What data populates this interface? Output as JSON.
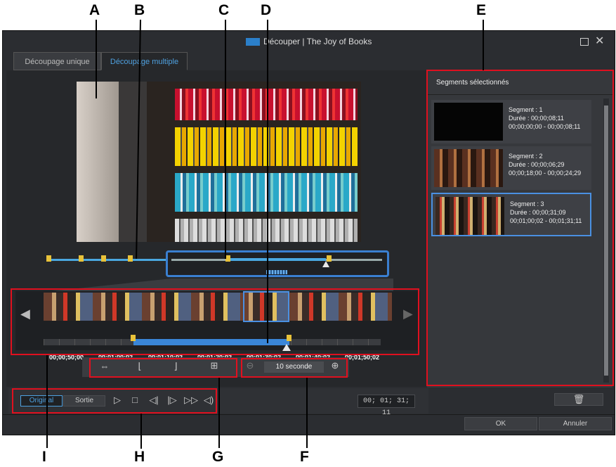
{
  "window": {
    "title": "Découper | The Joy of Books"
  },
  "tabs": [
    {
      "label": "Découpage unique",
      "active": false
    },
    {
      "label": "Découpage multiple",
      "active": true
    }
  ],
  "segments_panel": {
    "title": "Segments sélectionnés",
    "segments": [
      {
        "label": "Segment : 1",
        "duration": "Durée : 00;00;08;11",
        "range": "00;00;00;00 - 00;00;08;11",
        "selected": false
      },
      {
        "label": "Segment : 2",
        "duration": "Durée : 00;00;06;29",
        "range": "00;00;18;00 - 00;00;24;29",
        "selected": false
      },
      {
        "label": "Segment : 3",
        "duration": "Durée : 00;00;31;09",
        "range": "00;01;00;02 - 00;01;31;11",
        "selected": true
      }
    ]
  },
  "filmstrip": {
    "timestamps": [
      "00;00;50;00",
      "00;01;00;02",
      "00;01;10;02",
      "00;01;20;02",
      "00;01;30;02",
      "00;01;40;02",
      "00;01;50;02"
    ]
  },
  "zoom": {
    "value": "10 seconde"
  },
  "playback": {
    "original_label": "Original",
    "output_label": "Sortie",
    "timecode": "00; 01; 31; 11"
  },
  "footer": {
    "ok_label": "OK",
    "cancel_label": "Annuler"
  },
  "callouts": {
    "A": "A",
    "B": "B",
    "C": "C",
    "D": "D",
    "E": "E",
    "F": "F",
    "G": "G",
    "H": "H",
    "I": "I"
  },
  "colors": {
    "accent": "#4ea0df",
    "callout_box": "#e0101f",
    "marker": "#e8c23a"
  },
  "icons": [
    "close-icon",
    "maximize-icon",
    "trim-icon",
    "mark-in-icon",
    "mark-out-icon",
    "split-icon",
    "zoom-out-icon",
    "zoom-in-icon",
    "play-icon",
    "stop-icon",
    "previous-frame-icon",
    "next-frame-icon",
    "fast-forward-icon",
    "volume-icon",
    "delete-icon",
    "scroll-left-icon",
    "scroll-right-icon"
  ]
}
